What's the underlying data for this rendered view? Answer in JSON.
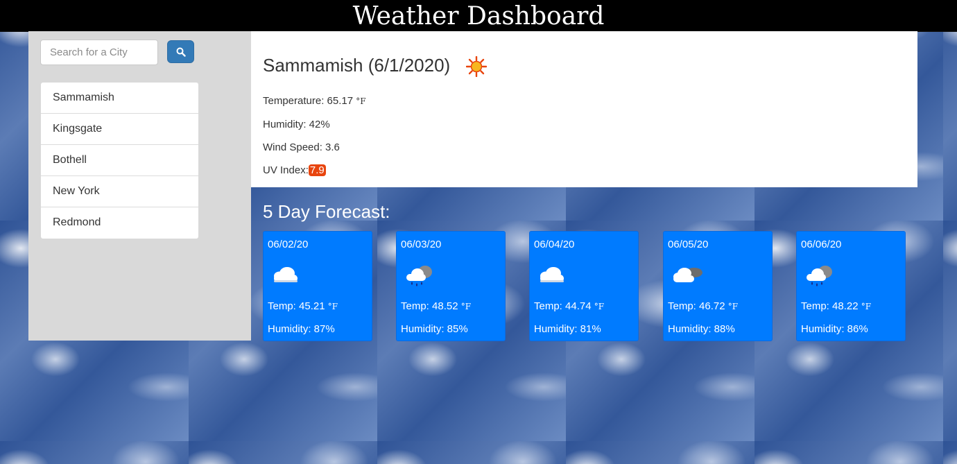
{
  "header": {
    "title": "Weather Dashboard"
  },
  "search": {
    "placeholder": "Search for a City",
    "button_icon": "search-icon"
  },
  "cities": [
    "Sammamish",
    "Kingsgate",
    "Bothell",
    "New York",
    "Redmond"
  ],
  "current": {
    "title": "Sammamish (6/1/2020)",
    "icon": "sun-icon",
    "temperature_label": "Temperature: 65.17",
    "unit": "°F",
    "humidity": "Humidity: 42%",
    "wind": "Wind Speed: 3.6",
    "uv_label": "UV Index:",
    "uv_value": "7.9",
    "uv_color": "#e8450e"
  },
  "forecast": {
    "heading": "5 Day Forecast:",
    "days": [
      {
        "date": "06/02/20",
        "icon": "cloud-icon",
        "temp": "Temp: 45.21",
        "humidity": "Humidity: 87%"
      },
      {
        "date": "06/03/20",
        "icon": "rain-cloud-icon",
        "temp": "Temp: 48.52",
        "humidity": "Humidity: 85%"
      },
      {
        "date": "06/04/20",
        "icon": "cloud-icon",
        "temp": "Temp: 44.74",
        "humidity": "Humidity: 81%"
      },
      {
        "date": "06/05/20",
        "icon": "broken-clouds-icon",
        "temp": "Temp: 46.72",
        "humidity": "Humidity: 88%"
      },
      {
        "date": "06/06/20",
        "icon": "rain-cloud-icon",
        "temp": "Temp: 48.22",
        "humidity": "Humidity: 86%"
      }
    ]
  },
  "colors": {
    "card": "#007bff",
    "button": "#337ab7",
    "sidebar": "#d9d9d9"
  }
}
